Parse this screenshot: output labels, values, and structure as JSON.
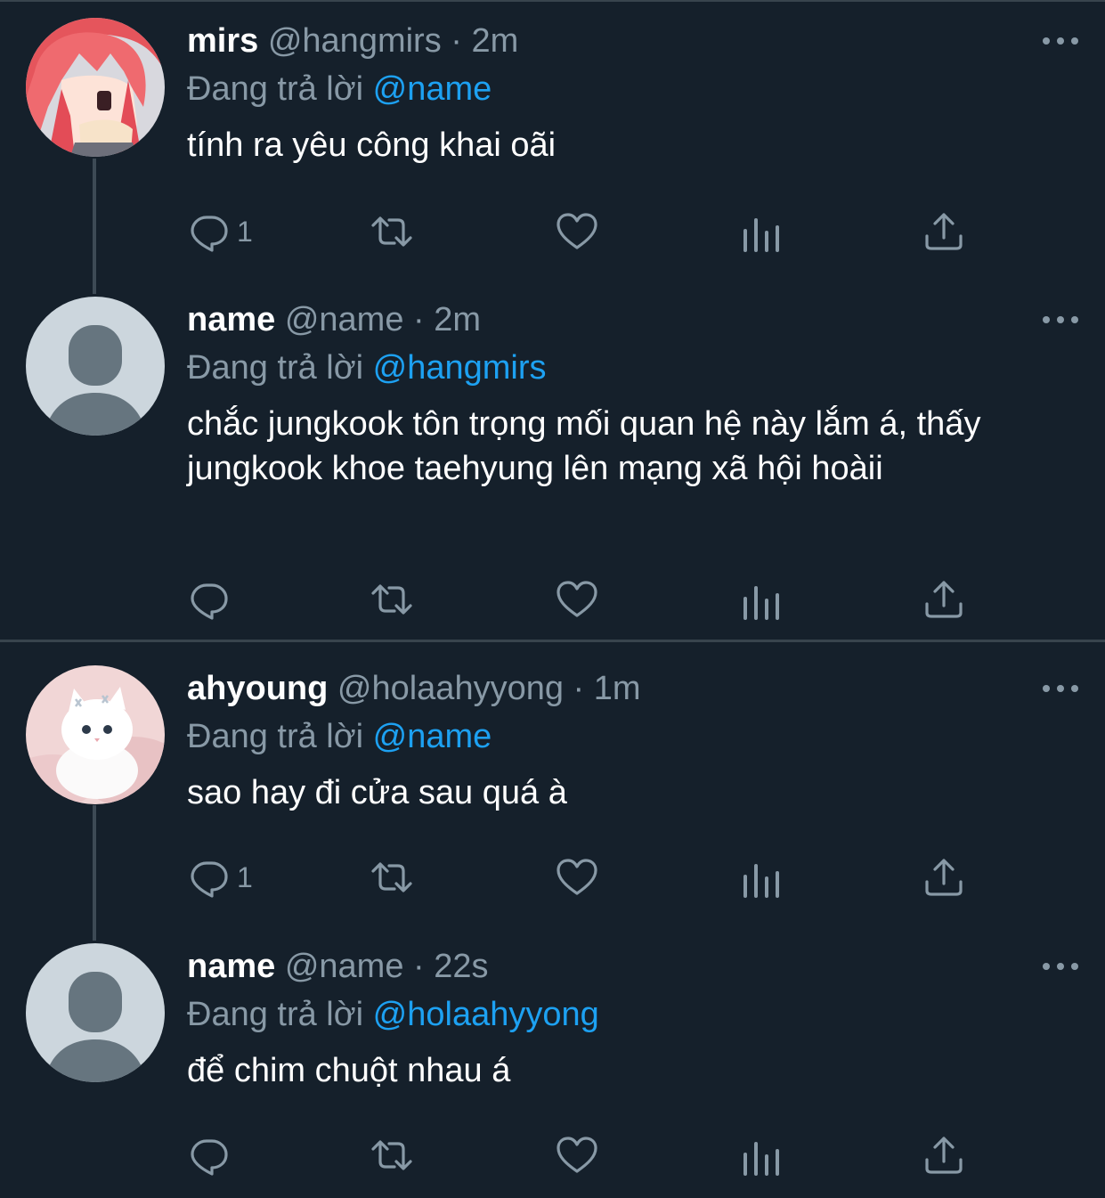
{
  "reply_prefix": "Đang trả lời",
  "tweets": [
    {
      "name": "mirs",
      "handle": "@hangmirs",
      "separator": "·",
      "time": "2m",
      "replying_to": "@name",
      "text": "tính ra yêu công khai oãi",
      "reply_count": "1",
      "avatar": "anime-girl-avatar"
    },
    {
      "name": "name",
      "handle": "@name",
      "separator": "·",
      "time": "2m",
      "replying_to": "@hangmirs",
      "text": "chắc jungkook tôn trọng mối quan hệ này lắm á, thấy jungkook khoe taehyung lên mạng xã hội hoàii",
      "reply_count": "",
      "avatar": "default-avatar"
    },
    {
      "name": "ahyoung",
      "handle": "@holaahyyong",
      "separator": "·",
      "time": "1m",
      "replying_to": "@name",
      "text": "sao hay đi cửa sau quá à",
      "reply_count": "1",
      "avatar": "white-kitten-avatar"
    },
    {
      "name": "name",
      "handle": "@name",
      "separator": "·",
      "time": "22s",
      "replying_to": "@holaahyyong",
      "text": "để chim chuột nhau á",
      "reply_count": "",
      "avatar": "default-avatar"
    }
  ],
  "colors": {
    "background": "#15202b",
    "text_primary": "#ffffff",
    "text_secondary": "#8899a6",
    "accent": "#1da1f2",
    "divider": "#38444d"
  },
  "icons": [
    "reply-icon",
    "retweet-icon",
    "like-icon",
    "analytics-icon",
    "share-icon",
    "more-icon"
  ]
}
